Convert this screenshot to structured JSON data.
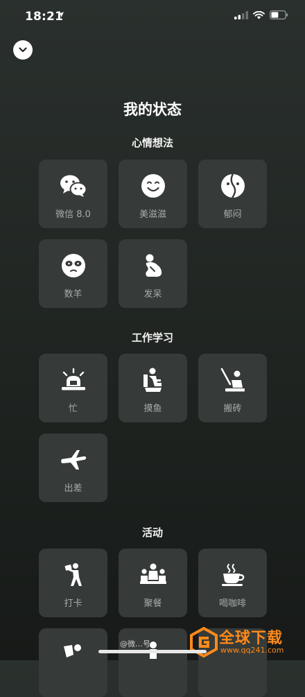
{
  "status_bar": {
    "time": "18:21"
  },
  "page": {
    "title": "我的状态"
  },
  "sections": [
    {
      "title": "心情想法",
      "items": [
        {
          "label": "微信 8.0",
          "icon": "wechat-icon"
        },
        {
          "label": "美滋滋",
          "icon": "smile-face-icon"
        },
        {
          "label": "郁闷",
          "icon": "leaf-face-icon"
        },
        {
          "label": "数羊",
          "icon": "sheep-face-icon"
        },
        {
          "label": "发呆",
          "icon": "daydream-icon"
        }
      ]
    },
    {
      "title": "工作学习",
      "items": [
        {
          "label": "忙",
          "icon": "siren-laptop-icon"
        },
        {
          "label": "摸鱼",
          "icon": "toilet-person-icon"
        },
        {
          "label": "搬砖",
          "icon": "worker-icon"
        },
        {
          "label": "出差",
          "icon": "airplane-icon"
        }
      ]
    },
    {
      "title": "活动",
      "items": [
        {
          "label": "打卡",
          "icon": "walking-photo-icon"
        },
        {
          "label": "聚餐",
          "icon": "group-dinner-icon"
        },
        {
          "label": "喝咖啡",
          "icon": "coffee-cup-icon"
        }
      ]
    }
  ],
  "watermark": {
    "text": "全球下载",
    "url": "www.qq241.com",
    "weibo": "@微…号"
  },
  "colors": {
    "tile_bg": "#363a38",
    "label": "#a8aca9",
    "watermark": "#ff8a1a"
  }
}
